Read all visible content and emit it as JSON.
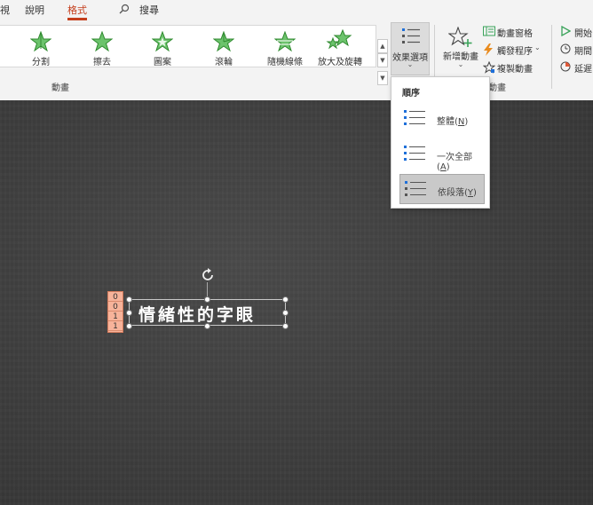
{
  "menu": {
    "view_partial": "視",
    "help": "說明",
    "format": "格式",
    "search": "搜尋"
  },
  "effects": [
    {
      "label": "分割",
      "icon": "star-split-icon"
    },
    {
      "label": "擦去",
      "icon": "star-wipe-icon"
    },
    {
      "label": "圖案",
      "icon": "star-shape-icon"
    },
    {
      "label": "滾輪",
      "icon": "star-wheel-icon"
    },
    {
      "label": "隨機線條",
      "icon": "star-random-bars-icon"
    },
    {
      "label": "放大及旋轉",
      "icon": "star-grow-turn-icon"
    }
  ],
  "groups": {
    "animation": "動畫",
    "advanced_partial": "動畫"
  },
  "effect_options": {
    "label": "效果選項"
  },
  "add_animation": {
    "label": "新增動畫"
  },
  "advanced": {
    "animation_pane": "動畫窗格",
    "trigger": "觸發程序",
    "animation_painter": "複製動畫"
  },
  "timing": {
    "start_partial": "開始",
    "duration_partial": "期間",
    "delay_partial": "延遲"
  },
  "dropdown": {
    "header": "順序",
    "items": [
      {
        "label": "整體",
        "key": "N",
        "selected": false
      },
      {
        "label": "一次全部",
        "key": "A",
        "selected": false
      },
      {
        "label": "依段落",
        "key": "Y",
        "selected": true
      }
    ]
  },
  "slide": {
    "text": "情緒性的字眼",
    "animation_tags": [
      "0",
      "0",
      "1",
      "1"
    ]
  },
  "colors": {
    "accent": "#c43e1c",
    "star_green": "#5cb85c",
    "dropdown_selected": "#c9c9c9",
    "anim_tag": "#f7b39a"
  }
}
